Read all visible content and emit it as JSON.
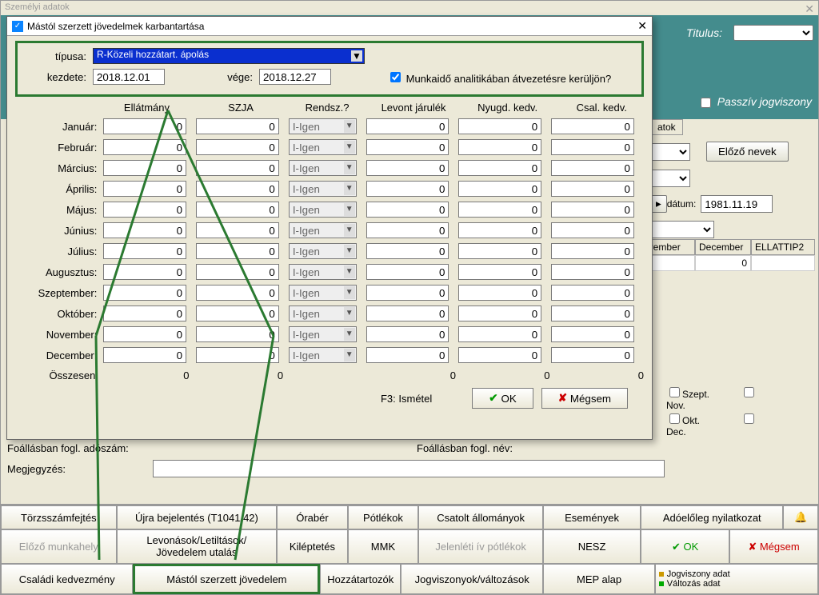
{
  "window": {
    "title": "Személyi adatok"
  },
  "teal": {
    "titulus": "Titulus:",
    "passziv": "Passzív jogviszony"
  },
  "right": {
    "atok_tab": "atok",
    "elozo": "Előző nevek",
    "datum_lbl": "dátum:",
    "datum_val": "1981.11.19"
  },
  "grid": {
    "c1": "ovember",
    "c2": "December",
    "c3": "ELLATTIP2",
    "v1": "0"
  },
  "checks": {
    "szept": "Szept.",
    "nov": "Nov.",
    "okt": "Okt.",
    "dec": "Dec."
  },
  "bg": {
    "foall_adoszam": "Foállásban fogl. adószám:",
    "foall_nev": "Foállásban fogl. név:",
    "megjegyzes": "Megjegyzés:"
  },
  "buttons": {
    "r1": [
      "Törzsszámfejtés",
      "Újra bejelentés (T1041/42)",
      "Órabér",
      "Pótlékok",
      "Csatolt állományok",
      "Események",
      "Adóelőleg nyilatkozat",
      ""
    ],
    "r2": [
      "Előző munkahely",
      "Levonások/Letiltások/\nJövedelem utalás",
      "Kiléptetés",
      "MMK",
      "Jelenléti ív pótlékok",
      "NESZ",
      "✔ OK",
      "✘ Mégsem"
    ],
    "r3": [
      "Családi kedvezmény",
      "Mástól szerzett jövedelem",
      "Hozzátartozók",
      "Jogviszonyok/változások",
      "MEP alap",
      ""
    ],
    "legend1": "Jogviszony adat",
    "legend2": "Változás adat"
  },
  "modal": {
    "title": "Mástól szerzett jövedelmek  karbantartása",
    "tipus_lbl": "típusa:",
    "tipus_val": "R-Közeli hozzátart. ápolás",
    "kezdete_lbl": "kezdete:",
    "kezdete_val": "2018.12.01",
    "vege_lbl": "vége:",
    "vege_val": "2018.12.27",
    "mun_chk": "Munkaidő analitikában átvezetésre kerüljön?",
    "cols": {
      "ell": "Ellátmány",
      "szja": "SZJA",
      "rend": "Rendsz.?",
      "lev": "Levont járulék",
      "nyug": "Nyugd. kedv.",
      "csal": "Csal. kedv."
    },
    "months": [
      "Január:",
      "Február:",
      "Március:",
      "Április:",
      "Május:",
      "Június:",
      "Július:",
      "Augusztus:",
      "Szeptember:",
      "Október:",
      "November:",
      "December:"
    ],
    "zero": "0",
    "igen": "I-Igen",
    "osszesen": "Összesen:",
    "f3": "F3: Ismétel",
    "ok": "OK",
    "megsem": "Mégsem"
  }
}
